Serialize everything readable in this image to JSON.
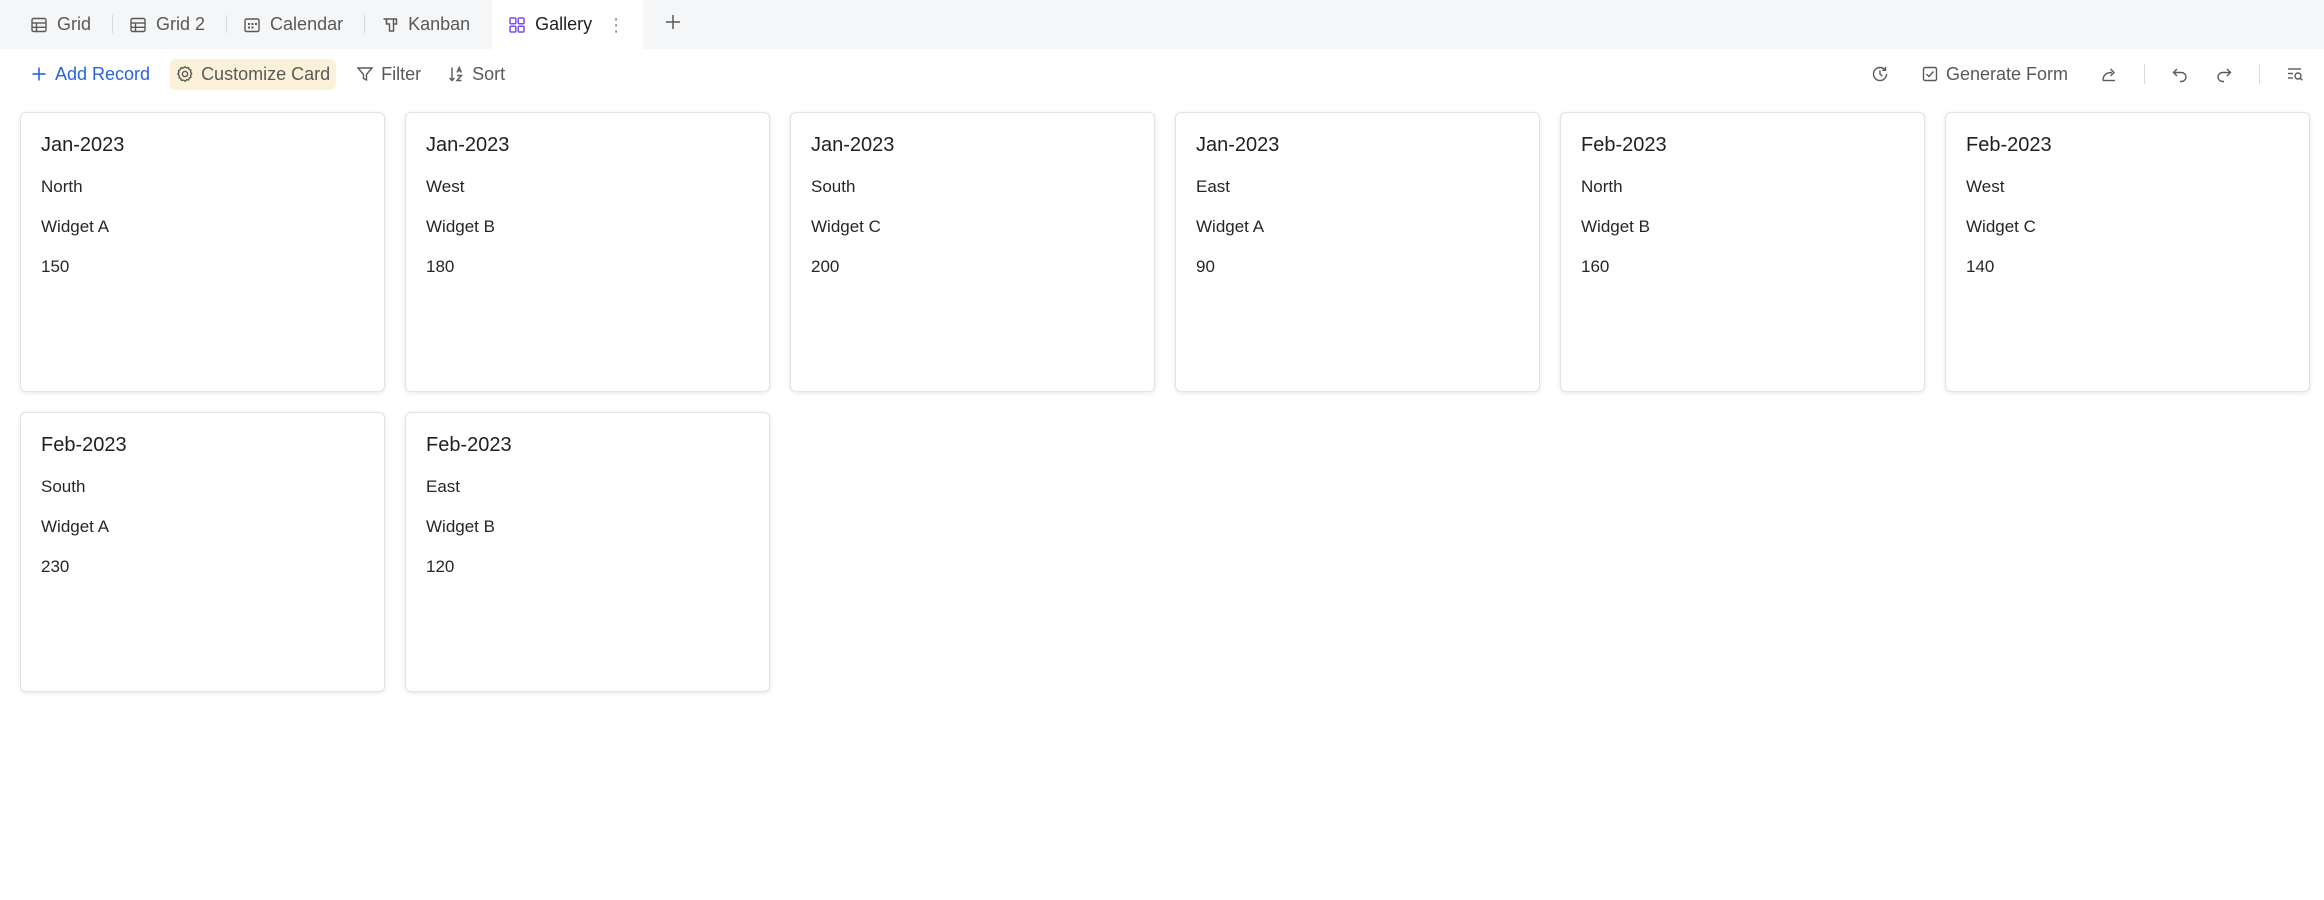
{
  "tabs": [
    {
      "label": "Grid",
      "icon": "grid-icon"
    },
    {
      "label": "Grid 2",
      "icon": "grid-icon"
    },
    {
      "label": "Calendar",
      "icon": "calendar-icon"
    },
    {
      "label": "Kanban",
      "icon": "kanban-icon"
    },
    {
      "label": "Gallery",
      "icon": "gallery-icon",
      "active": true
    }
  ],
  "toolbar": {
    "add_record": "Add Record",
    "customize_card": "Customize Card",
    "filter": "Filter",
    "sort": "Sort",
    "generate_form": "Generate Form"
  },
  "colors": {
    "accent": "#2b63d9",
    "active_tab_icon": "#7b4df0",
    "highlight_bg": "#fbf1d9"
  },
  "records": [
    {
      "title": "Jan-2023",
      "region": "North",
      "product": "Widget A",
      "value": "150"
    },
    {
      "title": "Jan-2023",
      "region": "West",
      "product": "Widget B",
      "value": "180"
    },
    {
      "title": "Jan-2023",
      "region": "South",
      "product": "Widget C",
      "value": "200"
    },
    {
      "title": "Jan-2023",
      "region": "East",
      "product": "Widget A",
      "value": "90"
    },
    {
      "title": "Feb-2023",
      "region": "North",
      "product": "Widget B",
      "value": "160"
    },
    {
      "title": "Feb-2023",
      "region": "West",
      "product": "Widget C",
      "value": "140"
    },
    {
      "title": "Feb-2023",
      "region": "South",
      "product": "Widget A",
      "value": "230"
    },
    {
      "title": "Feb-2023",
      "region": "East",
      "product": "Widget B",
      "value": "120"
    }
  ]
}
